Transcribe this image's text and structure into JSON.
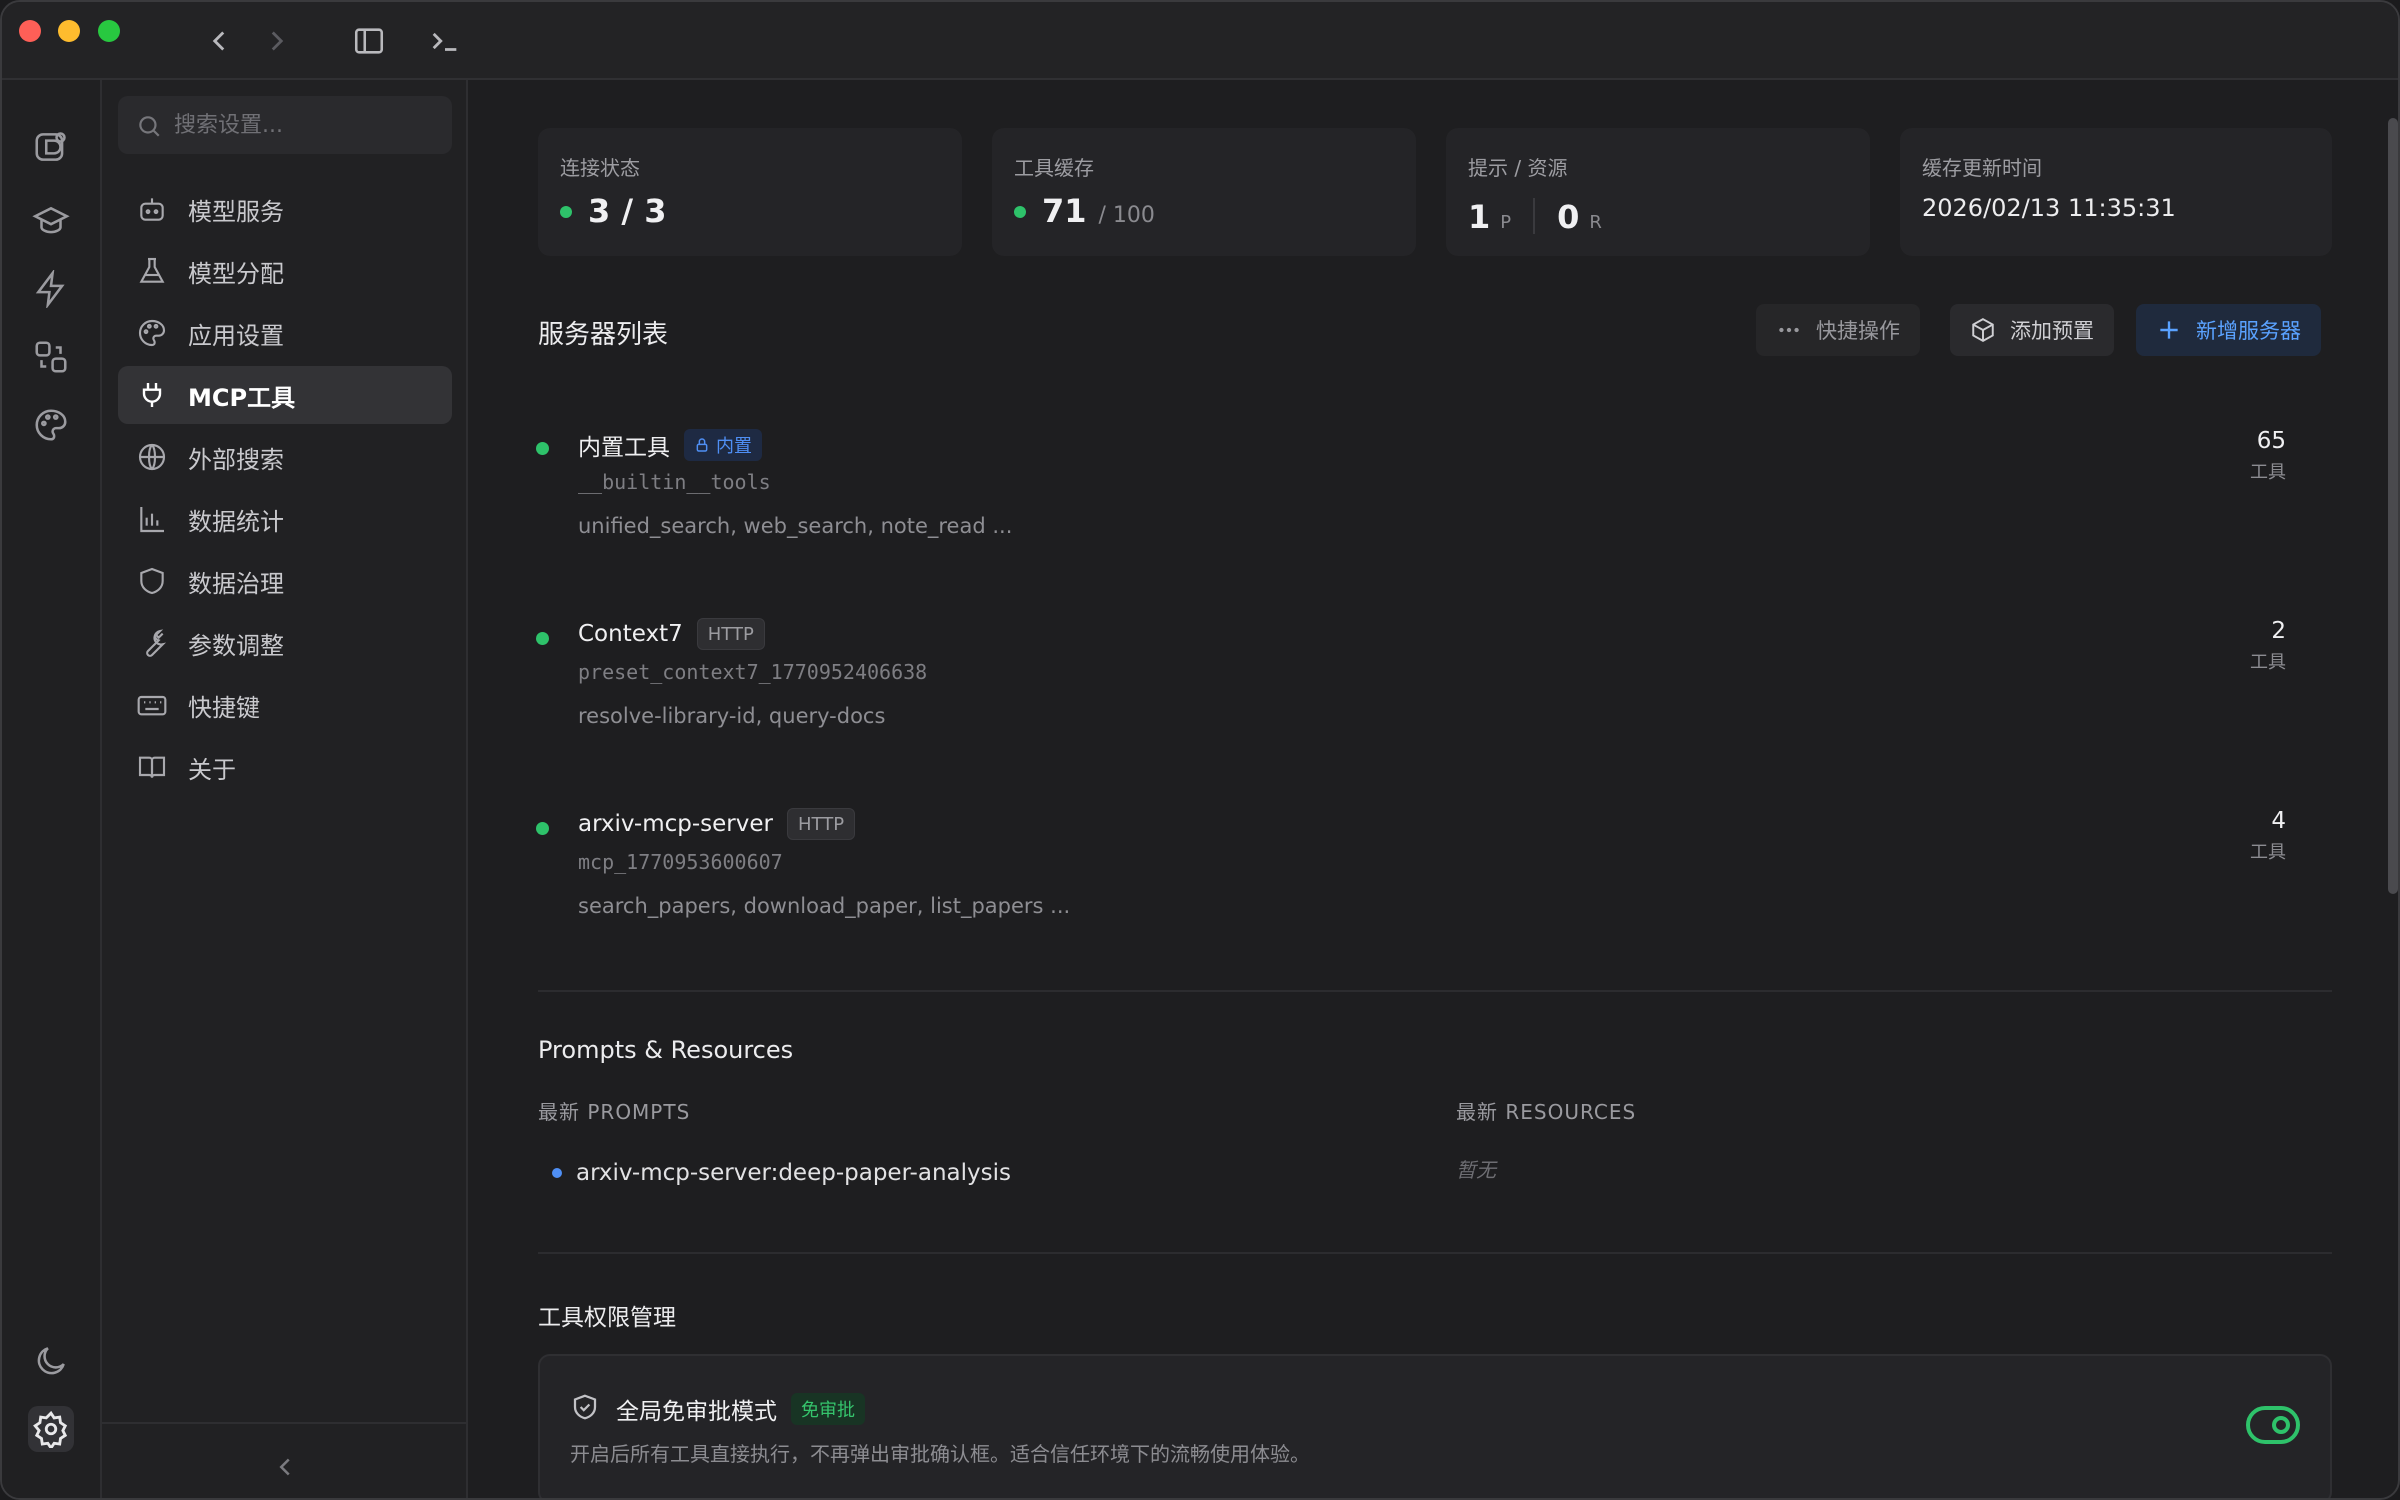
{
  "sidebar": {
    "search_placeholder": "搜索设置...",
    "items": [
      {
        "label": "模型服务",
        "icon": "robot-icon"
      },
      {
        "label": "模型分配",
        "icon": "flask-icon"
      },
      {
        "label": "应用设置",
        "icon": "palette-icon"
      },
      {
        "label": "MCP工具",
        "icon": "plug-icon",
        "active": true
      },
      {
        "label": "外部搜索",
        "icon": "globe-icon"
      },
      {
        "label": "数据统计",
        "icon": "bar-chart-icon"
      },
      {
        "label": "数据治理",
        "icon": "shield-icon"
      },
      {
        "label": "参数调整",
        "icon": "wrench-icon"
      },
      {
        "label": "快捷键",
        "icon": "keyboard-icon"
      },
      {
        "label": "关于",
        "icon": "book-icon"
      }
    ]
  },
  "stats": {
    "connection": {
      "label": "连接状态",
      "value": "3 / 3"
    },
    "cache": {
      "label": "工具缓存",
      "value": "71",
      "total": "/ 100"
    },
    "prompts_resources": {
      "label": "提示 / 资源",
      "prompts": "1",
      "prompts_unit": "P",
      "resources": "0",
      "resources_unit": "R"
    },
    "updated": {
      "label": "缓存更新时间",
      "value": "2026/02/13 11:35:31"
    }
  },
  "server_list": {
    "title": "服务器列表",
    "quick_actions": "快捷操作",
    "add_preset": "添加预置",
    "add_server": "新增服务器",
    "servers": [
      {
        "name": "内置工具",
        "tag": "内置",
        "id": "__builtin__tools",
        "tools": "unified_search, web_search, note_read ...",
        "count": "65",
        "count_unit": "工具"
      },
      {
        "name": "Context7",
        "tag": "HTTP",
        "id": "preset_context7_1770952406638",
        "tools": "resolve-library-id, query-docs",
        "count": "2",
        "count_unit": "工具"
      },
      {
        "name": "arxiv-mcp-server",
        "tag": "HTTP",
        "id": "mcp_1770953600607",
        "tools": "search_papers, download_paper, list_papers ...",
        "count": "4",
        "count_unit": "工具"
      }
    ]
  },
  "prompts_resources": {
    "title": "Prompts & Resources",
    "prompts_head": "最新 PROMPTS",
    "resources_head": "最新 RESOURCES",
    "prompt_item": "arxiv-mcp-server:deep-paper-analysis",
    "resources_empty": "暂无"
  },
  "permissions": {
    "title": "工具权限管理",
    "card_title": "全局免审批模式",
    "badge": "免审批",
    "desc": "开启后所有工具直接执行，不再弹出审批确认框。适合信任环境下的流畅使用体验。",
    "enabled": true
  },
  "colors": {
    "accent": "#4f8ff5",
    "success": "#2ec26a"
  }
}
